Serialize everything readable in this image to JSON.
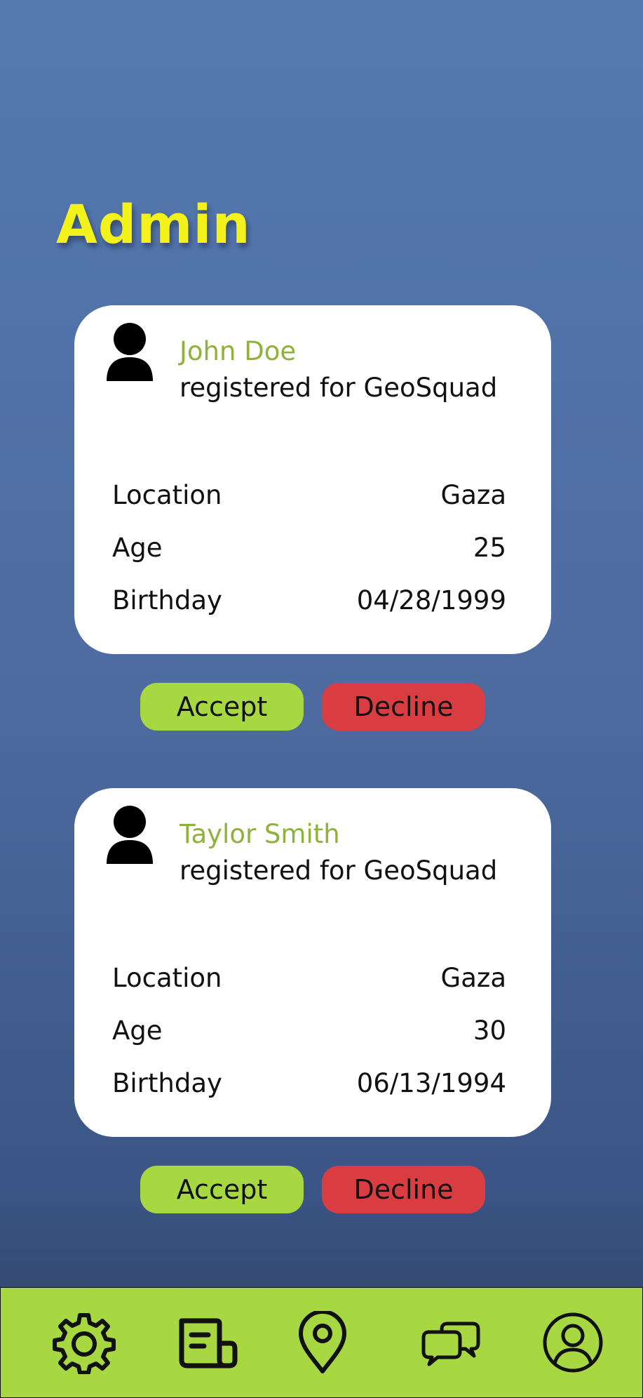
{
  "page": {
    "title": "Admin"
  },
  "requests": [
    {
      "name": "John Doe",
      "subtitle": "registered for GeoSquad",
      "details": [
        {
          "label": "Location",
          "value": "Gaza"
        },
        {
          "label": "Age",
          "value": "25"
        },
        {
          "label": "Birthday",
          "value": "04/28/1999"
        }
      ],
      "accept_label": "Accept",
      "decline_label": "Decline"
    },
    {
      "name": "Taylor Smith",
      "subtitle": "registered for GeoSquad",
      "details": [
        {
          "label": "Location",
          "value": "Gaza"
        },
        {
          "label": "Age",
          "value": "30"
        },
        {
          "label": "Birthday",
          "value": "06/13/1994"
        }
      ],
      "accept_label": "Accept",
      "decline_label": "Decline"
    }
  ],
  "nav": {
    "items": [
      "gear-icon",
      "document-icon",
      "location-pin-icon",
      "chat-icon",
      "profile-icon"
    ]
  },
  "colors": {
    "title": "#f3f21a",
    "name": "#8fb33a",
    "accept": "#a7d841",
    "decline": "#d93d41",
    "navbar": "#a7d841"
  }
}
